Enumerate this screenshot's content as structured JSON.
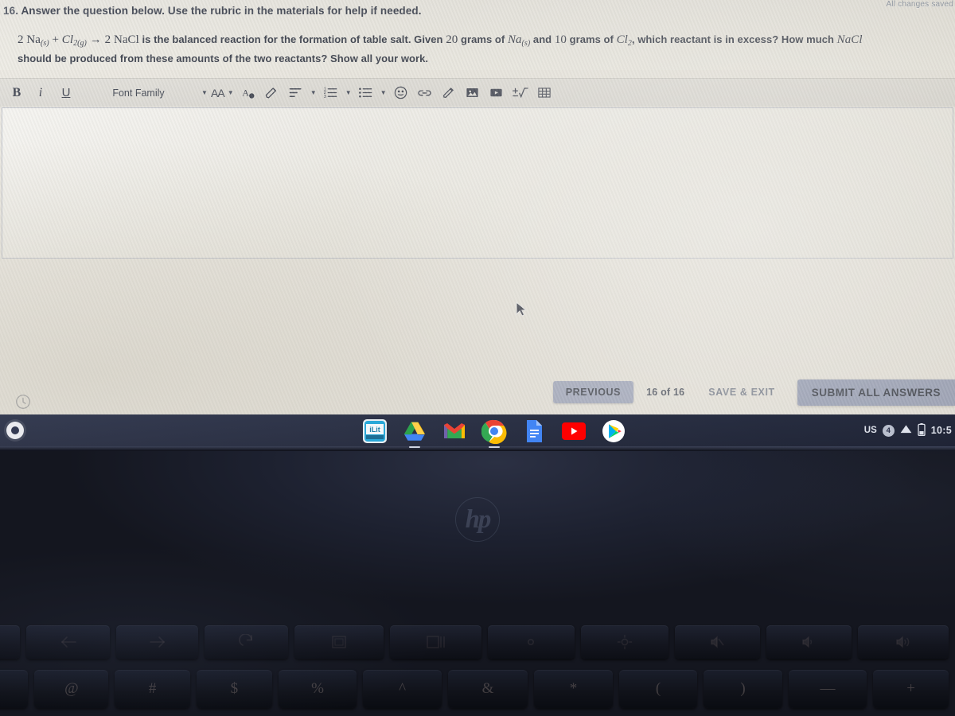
{
  "assessment": {
    "save_status": "All changes saved",
    "question_number": "16.",
    "prompt": "Answer the question below. Use the rubric in the materials for help if needed.",
    "body_line1_equation_lhs": "2 Na",
    "body_line1_sub_s": "(s)",
    "body_line1_plus": " + ",
    "body_line1_cl": "Cl",
    "body_line1_sub_2g": "2(g)",
    "body_line1_arrow": " → ",
    "body_line1_rhs": "2 NaCl",
    "body_text_a": " is the balanced reaction for the formation of table salt. Given ",
    "body_num_20": "20",
    "body_text_b": " grams of ",
    "body_na": "Na",
    "body_na_sub": "(s)",
    "body_text_c": " and ",
    "body_num_10": "10",
    "body_text_d": " grams of ",
    "body_cl2": "Cl",
    "body_cl2_sub": "2",
    "body_text_e": ", which reactant is in excess? How much ",
    "body_nacl": "NaCl",
    "body_line2": "should be produced from these amounts of the two reactants? Show all your work."
  },
  "toolbar": {
    "bold_label": "B",
    "italic_label": "i",
    "underline_label": "U",
    "font_family_label": "Font Family",
    "font_size_label": "AA",
    "icons": [
      "text-color-icon",
      "highlight-icon",
      "align-icon",
      "numbered-list-icon",
      "bullet-list-icon",
      "emoji-icon",
      "link-icon",
      "draw-icon",
      "image-icon",
      "video-icon",
      "equation-icon",
      "table-icon"
    ]
  },
  "editor": {
    "answer_value": "",
    "answer_placeholder": ""
  },
  "navigation": {
    "previous_label": "PREVIOUS",
    "counter_label": "16 of 16",
    "save_exit_label": "SAVE & EXIT",
    "submit_label": "SUBMIT ALL ANSWERS"
  },
  "shelf": {
    "launcher_name": "launcher-button",
    "apps": [
      {
        "name": "ilit-app-icon",
        "label": "iLit",
        "running": false
      },
      {
        "name": "google-drive-icon",
        "label": "",
        "running": true
      },
      {
        "name": "gmail-icon",
        "label": "",
        "running": false
      },
      {
        "name": "chrome-icon",
        "label": "",
        "running": true
      },
      {
        "name": "google-docs-icon",
        "label": "",
        "running": false
      },
      {
        "name": "youtube-icon",
        "label": "",
        "running": false
      },
      {
        "name": "play-store-icon",
        "label": "",
        "running": false
      }
    ],
    "tray": {
      "keyboard_layout": "US",
      "notification_count": "4",
      "wifi_icon": "wifi-icon",
      "battery_icon": "battery-icon",
      "time": "10:5"
    }
  },
  "hardware": {
    "brand_logo": "hp",
    "function_keys": [
      "back-key",
      "forward-key",
      "reload-key",
      "fullscreen-key",
      "overview-key",
      "brightness-down-key",
      "brightness-up-key",
      "mute-key",
      "volume-down-key",
      "volume-up-key"
    ],
    "number_row_symbols": [
      "!",
      "@",
      "#",
      "$",
      "%",
      "^",
      "&",
      "*",
      "(",
      ")",
      "—"
    ]
  }
}
